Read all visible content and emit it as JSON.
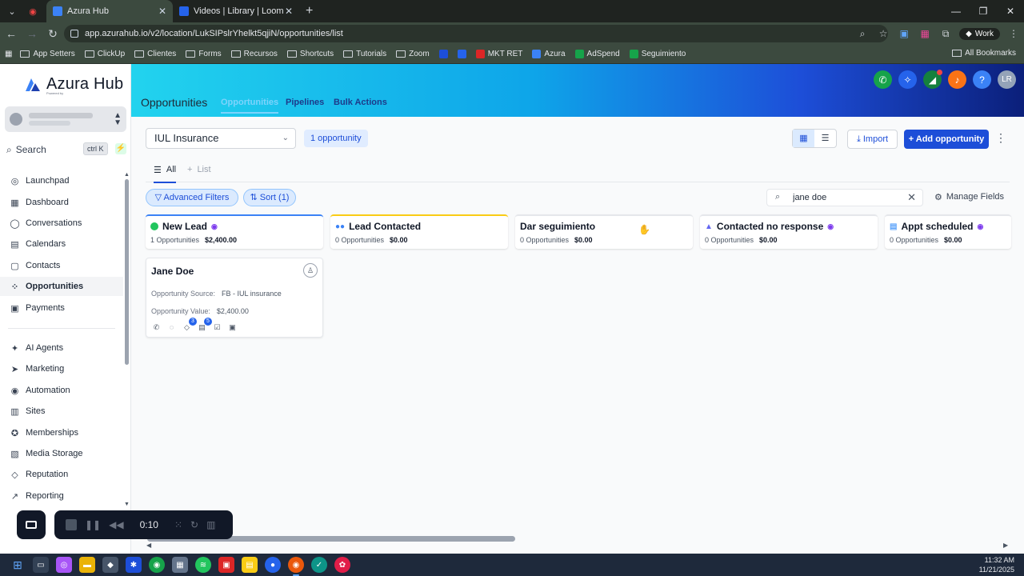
{
  "browser": {
    "tabs": [
      {
        "title": "Azura Hub",
        "active": true,
        "color": "#3b82f6"
      },
      {
        "title": "Videos | Library | Loom",
        "active": false,
        "color": "#2563eb"
      }
    ],
    "url": "app.azurahub.io/v2/location/LukSIPslrYhelkt5qjiN/opportunities/list",
    "profile": "Work",
    "bookmarks": [
      {
        "label": "App Setters",
        "type": "folder"
      },
      {
        "label": "ClickUp",
        "type": "folder"
      },
      {
        "label": "Clientes",
        "type": "folder"
      },
      {
        "label": "Forms",
        "type": "folder"
      },
      {
        "label": "Recursos",
        "type": "folder"
      },
      {
        "label": "Shortcuts",
        "type": "folder"
      },
      {
        "label": "Tutorials",
        "type": "folder"
      },
      {
        "label": "Zoom",
        "type": "folder"
      },
      {
        "label": "",
        "type": "fav",
        "color": "#1d4ed8"
      },
      {
        "label": "",
        "type": "fav",
        "color": "#2563eb"
      },
      {
        "label": "MKT RET",
        "type": "fav",
        "color": "#dc2626"
      },
      {
        "label": "Azura",
        "type": "fav",
        "color": "#3b82f6"
      },
      {
        "label": "AdSpend",
        "type": "fav",
        "color": "#16a34a"
      },
      {
        "label": "Seguimiento",
        "type": "fav",
        "color": "#16a34a"
      }
    ],
    "all_bookmarks": "All Bookmarks"
  },
  "sidebar": {
    "logo_text": "Azura Hub",
    "logo_sub": "Powered by",
    "search_label": "Search",
    "search_shortcut": "ctrl K",
    "items": [
      {
        "label": "Launchpad",
        "icon": "rocket-icon",
        "glyph": "◎"
      },
      {
        "label": "Dashboard",
        "icon": "dashboard-icon",
        "glyph": "▦"
      },
      {
        "label": "Conversations",
        "icon": "chat-icon",
        "glyph": "◯"
      },
      {
        "label": "Calendars",
        "icon": "calendar-icon",
        "glyph": "▤"
      },
      {
        "label": "Contacts",
        "icon": "contacts-icon",
        "glyph": "▢"
      },
      {
        "label": "Opportunities",
        "icon": "opportunities-icon",
        "glyph": "⁘"
      },
      {
        "label": "Payments",
        "icon": "payments-icon",
        "glyph": "▣"
      },
      {
        "label": "AI Agents",
        "icon": "ai-agents-icon",
        "glyph": "✦"
      },
      {
        "label": "Marketing",
        "icon": "marketing-icon",
        "glyph": "➤"
      },
      {
        "label": "Automation",
        "icon": "automation-icon",
        "glyph": "◉"
      },
      {
        "label": "Sites",
        "icon": "sites-icon",
        "glyph": "▥"
      },
      {
        "label": "Memberships",
        "icon": "memberships-icon",
        "glyph": "✪"
      },
      {
        "label": "Media Storage",
        "icon": "media-storage-icon",
        "glyph": "▧"
      },
      {
        "label": "Reputation",
        "icon": "reputation-icon",
        "glyph": "◇"
      },
      {
        "label": "Reporting",
        "icon": "reporting-icon",
        "glyph": "↗"
      }
    ],
    "active_item": "Opportunities"
  },
  "header": {
    "title": "Opportunities",
    "tabs": [
      "Opportunities",
      "Pipelines",
      "Bulk Actions"
    ],
    "current_tab": "Opportunities",
    "avatar_initials": "LR"
  },
  "toolbar": {
    "pipeline": "IUL Insurance",
    "count": "1 opportunity",
    "import_label": "Import",
    "add_label": "Add opportunity"
  },
  "views": {
    "all": "All",
    "list": "List"
  },
  "filters": {
    "advanced": "Advanced Filters",
    "sort": "Sort (1)",
    "search_value": "jane doe",
    "manage_fields": "Manage Fields"
  },
  "stages": [
    {
      "name": "New Lead",
      "count": "1 Opportunities",
      "value": "$2,400.00",
      "color": "#22c55e",
      "accent": "#3b82f6",
      "robot": true
    },
    {
      "name": "Lead Contacted",
      "count": "0 Opportunities",
      "value": "$0.00",
      "color": "#3b82f6",
      "accent": "#facc15",
      "robot": false
    },
    {
      "name": "Dar seguimiento",
      "count": "0 Opportunities",
      "value": "$0.00",
      "color": "",
      "accent": "#e5e7eb",
      "robot": false
    },
    {
      "name": "Contacted no response",
      "count": "0 Opportunities",
      "value": "$0.00",
      "color": "#6366f1",
      "accent": "#e5e7eb",
      "robot": true
    },
    {
      "name": "Appt scheduled",
      "count": "0 Opportunities",
      "value": "$0.00",
      "color": "#60a5fa",
      "accent": "#e5e7eb",
      "robot": true
    }
  ],
  "card": {
    "name": "Jane Doe",
    "source_label": "Opportunity Source:",
    "source_value": "FB - IUL insurance",
    "value_label": "Opportunity Value:",
    "value_value": "$2,400.00",
    "badges": {
      "tags": "3",
      "notes": "5"
    }
  },
  "loom": {
    "time": "0:10"
  },
  "taskbar": {
    "time": "11:32 AM",
    "date": "11/21/2025"
  },
  "colors": {
    "primary": "#1d4ed8",
    "accent_green": "#16a34a"
  }
}
